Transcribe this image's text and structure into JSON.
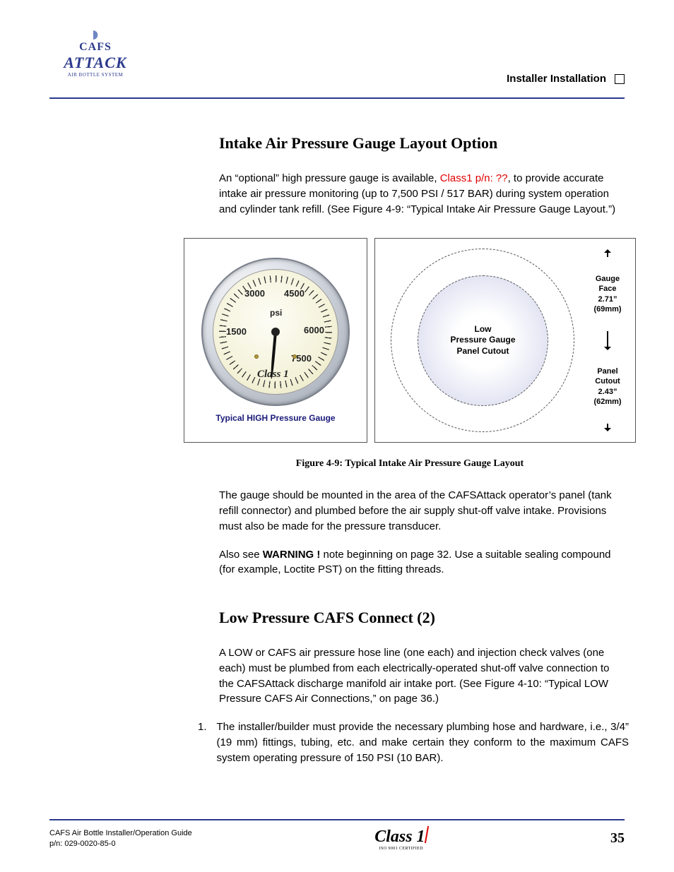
{
  "header": {
    "section_title": "Installer Installation",
    "logo": {
      "line1": "CAFS",
      "line2": "ATTACK",
      "line3": "AIR BOTTLE SYSTEM"
    }
  },
  "section_a": {
    "heading": "Intake Air Pressure Gauge Layout Option",
    "p1_a": "An “optional” high pressure gauge is available, ",
    "p1_red": "Class1 p/n: ??",
    "p1_b": ", to provide accurate intake air pressure monitoring (up to 7,500 PSI / 517 BAR) during system operation and cylinder tank refill.  (See Figure 4-9: “Typical Intake Air Pressure Gauge Layout.”)"
  },
  "figure": {
    "gauge": {
      "n1500": "1500",
      "n3000": "3000",
      "n4500": "4500",
      "n6000": "6000",
      "n7500": "7500",
      "unit": "psi",
      "brand": "Class 1"
    },
    "left_caption": "Typical HIGH Pressure Gauge",
    "cutout_label_l1": "Low",
    "cutout_label_l2": "Pressure Gauge",
    "cutout_label_l3": "Panel Cutout",
    "dim_face_l1": "Gauge",
    "dim_face_l2": "Face",
    "dim_face_l3": "2.71”",
    "dim_face_l4": "(69mm)",
    "dim_cut_l1": "Panel",
    "dim_cut_l2": "Cutout",
    "dim_cut_l3": "2.43”",
    "dim_cut_l4": "(62mm)",
    "caption": "Figure 4-9:  Typical Intake Air Pressure Gauge Layout"
  },
  "after_fig": {
    "p2": "The gauge should be mounted in the area of the CAFSAttack operator’s panel (tank refill connector) and plumbed before the air supply shut-off valve intake.  Provisions must also be made for the pressure transducer.",
    "p3_a": "Also see ",
    "p3_b": "WARNING !",
    "p3_c": " note beginning on page 32.  Use a suitable sealing compound (for example, Loctite PST) on the fitting threads."
  },
  "section_b": {
    "heading": "Low Pressure CAFS Connect (2)",
    "p1": "A LOW or CAFS air pressure hose line (one each) and injection check valves (one each) must be plumbed from each electrically-operated shut-off valve connection to the CAFSAttack discharge manifold air intake port.  (See Figure 4-10: “Typical LOW Pressure CAFS Air Connections,” on page 36.)",
    "li1_n": "1.",
    "li1": "The installer/builder must provide the necessary plumbing hose and hardware, i.e., 3/4” (19 mm) fittings, tubing, etc. and make certain they conform to the maximum CAFS system operating pressure of 150 PSI (10 BAR)."
  },
  "footer": {
    "doc_title": "CAFS Air Bottle Installer/Operation Guide",
    "pn": "p/n: 029-0020-85-0",
    "brand": "Class 1",
    "iso": "ISO 9001 CERTIFIED",
    "page": "35"
  }
}
